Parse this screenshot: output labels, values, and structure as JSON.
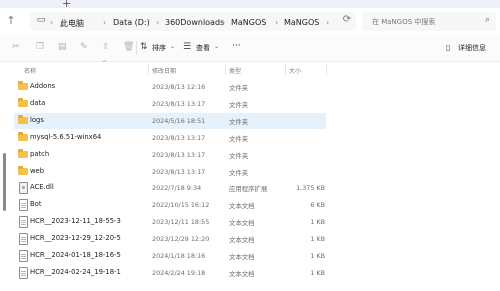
{
  "address": {
    "crumbs": [
      "此电脑",
      "Data (D:)",
      "360Downloads",
      "MaNGOS",
      "MaNGOS"
    ],
    "search_placeholder": "在 MaNGOS 中搜索"
  },
  "commands": {
    "sort_label": "排序",
    "view_label": "查看",
    "more_label": "···",
    "details_label": "详细信息"
  },
  "columns": {
    "name": "名称",
    "date": "修改日期",
    "type": "类型",
    "size": "大小"
  },
  "files": [
    {
      "name": "Addons",
      "date": "2023/8/13 12:16",
      "type": "文件夹",
      "size": "",
      "kind": "folder"
    },
    {
      "name": "data",
      "date": "2023/8/13 13:17",
      "type": "文件夹",
      "size": "",
      "kind": "folder"
    },
    {
      "name": "logs",
      "date": "2024/5/16 18:51",
      "type": "文件夹",
      "size": "",
      "kind": "folder"
    },
    {
      "name": "mysql-5.6.51-winx64",
      "date": "2023/8/13 13:17",
      "type": "文件夹",
      "size": "",
      "kind": "folder"
    },
    {
      "name": "patch",
      "date": "2023/8/13 13:17",
      "type": "文件夹",
      "size": "",
      "kind": "folder"
    },
    {
      "name": "web",
      "date": "2023/8/13 13:17",
      "type": "文件夹",
      "size": "",
      "kind": "folder"
    },
    {
      "name": "ACE.dll",
      "date": "2022/7/18 9:34",
      "type": "应用程序扩展",
      "size": "1,375 KB",
      "kind": "dll"
    },
    {
      "name": "Bot",
      "date": "2022/10/15 16:12",
      "type": "文本文档",
      "size": "6 KB",
      "kind": "file"
    },
    {
      "name": "HCR__2023-12-11_18-55-3",
      "date": "2023/12/11 18:55",
      "type": "文本文档",
      "size": "1 KB",
      "kind": "file"
    },
    {
      "name": "HCR__2023-12-29_12-20-5",
      "date": "2023/12/29 12:20",
      "type": "文本文档",
      "size": "1 KB",
      "kind": "file"
    },
    {
      "name": "HCR__2024-01-18_18-16-5",
      "date": "2024/1/18 18:16",
      "type": "文本文档",
      "size": "1 KB",
      "kind": "file"
    },
    {
      "name": "HCR__2024-02-24_19-18-1",
      "date": "2024/2/24 19:18",
      "type": "文本文档",
      "size": "1 KB",
      "kind": "file"
    }
  ],
  "selected_index": 2
}
